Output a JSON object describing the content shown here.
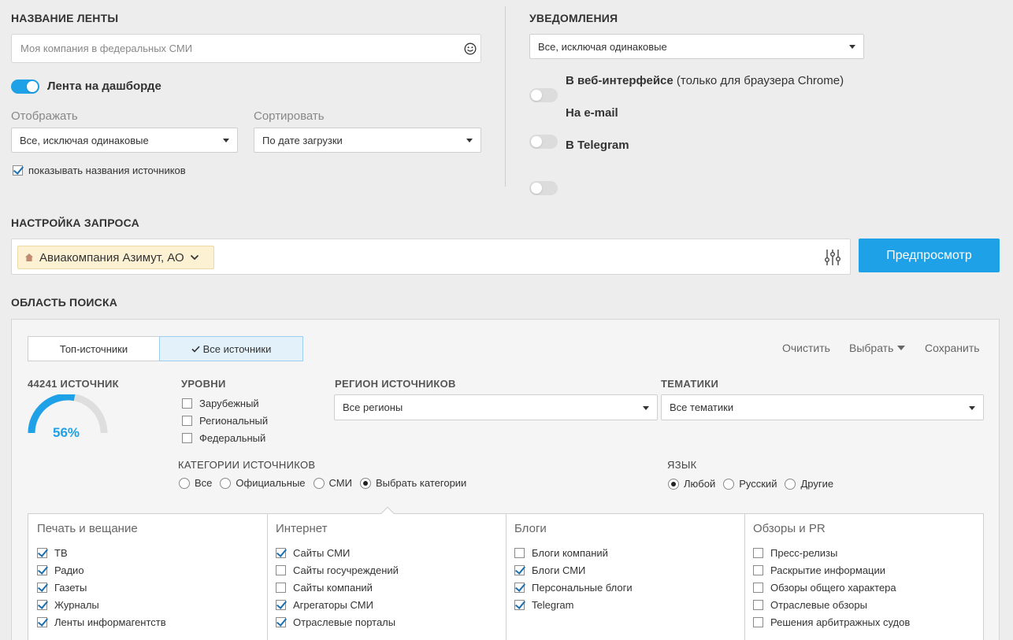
{
  "feed_name": {
    "title": "НАЗВАНИЕ ЛЕНТЫ",
    "placeholder": "Моя компания в федеральных СМИ",
    "emoji_icon": "smiley-icon"
  },
  "dashboard_toggle": {
    "label": "Лента на дашборде",
    "on": true
  },
  "display": {
    "label": "Отображать",
    "value": "Все, исключая одинаковые"
  },
  "sort": {
    "label": "Сортировать",
    "value": "По дате загрузки"
  },
  "show_source_names": {
    "label": "показывать названия источников",
    "checked": true
  },
  "notifications": {
    "title": "УВЕДОМЛЕНИЯ",
    "select_value": "Все, исключая одинаковые",
    "web": {
      "label_bold": "В веб-интерфейсе",
      "label_rest": " (только для браузера Chrome)"
    },
    "email": {
      "label": "На e-mail"
    },
    "telegram": {
      "label": "В Telegram"
    }
  },
  "query": {
    "title": "НАСТРОЙКА ЗАПРОСА",
    "tag_label": "Авиакомпания Азимут, АО",
    "preview_button": "Предпросмотр"
  },
  "search_area": {
    "title": "ОБЛАСТЬ ПОИСКА",
    "tabs": [
      "Топ-источники",
      "Все источники"
    ],
    "actions": {
      "clear": "Очистить",
      "select": "Выбрать",
      "save": "Сохранить"
    },
    "sources_count": "44241 ИСТОЧНИК",
    "gauge_percent": 56,
    "gauge_label": "56%",
    "levels": {
      "title": "УРОВНИ",
      "items": [
        {
          "label": "Зарубежный",
          "checked": false
        },
        {
          "label": "Региональный",
          "checked": false
        },
        {
          "label": "Федеральный",
          "checked": false
        }
      ]
    },
    "region": {
      "title": "РЕГИОН ИСТОЧНИКОВ",
      "value": "Все регионы"
    },
    "topics": {
      "title": "ТЕМАТИКИ",
      "value": "Все тематики"
    },
    "categories": {
      "title": "КАТЕГОРИИ ИСТОЧНИКОВ",
      "options": [
        "Все",
        "Официальные",
        "СМИ",
        "Выбрать категории"
      ],
      "selected": 3
    },
    "language": {
      "title": "ЯЗЫК",
      "options": [
        "Любой",
        "Русский",
        "Другие"
      ],
      "selected": 0
    },
    "columns": [
      {
        "title": "Печать и вещание",
        "items": [
          {
            "label": "ТВ",
            "checked": true
          },
          {
            "label": "Радио",
            "checked": true
          },
          {
            "label": "Газеты",
            "checked": true
          },
          {
            "label": "Журналы",
            "checked": true
          },
          {
            "label": "Ленты информагентств",
            "checked": true
          }
        ]
      },
      {
        "title": "Интернет",
        "items": [
          {
            "label": "Сайты СМИ",
            "checked": true
          },
          {
            "label": "Сайты госучреждений",
            "checked": false
          },
          {
            "label": "Сайты компаний",
            "checked": false
          },
          {
            "label": "Агрегаторы СМИ",
            "checked": true
          },
          {
            "label": "Отраслевые порталы",
            "checked": true
          }
        ]
      },
      {
        "title": "Блоги",
        "items": [
          {
            "label": "Блоги компаний",
            "checked": false
          },
          {
            "label": "Блоги СМИ",
            "checked": true
          },
          {
            "label": "Персональные блоги",
            "checked": true
          },
          {
            "label": "Telegram",
            "checked": true
          }
        ]
      },
      {
        "title": "Обзоры и PR",
        "items": [
          {
            "label": "Пресс-релизы",
            "checked": false
          },
          {
            "label": "Раскрытие информации",
            "checked": false
          },
          {
            "label": "Обзоры общего характера",
            "checked": false
          },
          {
            "label": "Отраслевые обзоры",
            "checked": false
          },
          {
            "label": "Решения арбитражных судов",
            "checked": false
          }
        ]
      }
    ]
  },
  "colors": {
    "accent": "#1ea1e6",
    "tag_bg": "#fdf1d3",
    "gauge_track": "#dedede"
  }
}
